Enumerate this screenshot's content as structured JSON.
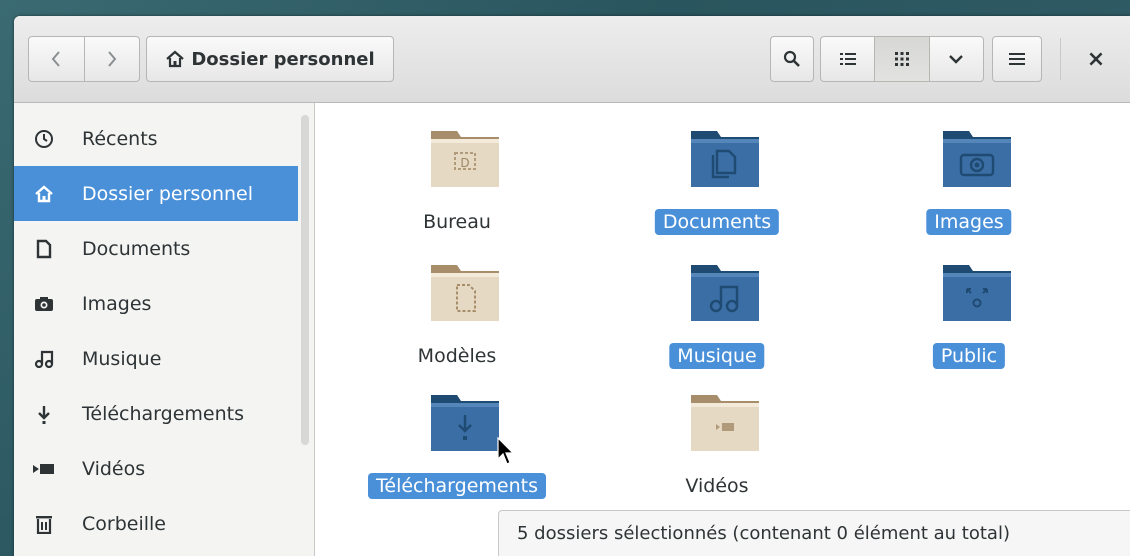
{
  "header": {
    "back_label": "<",
    "forward_label": ">",
    "path_label": "Dossier personnel",
    "close_label": "×"
  },
  "colors": {
    "accent": "#4a90d9",
    "folder_blue": "#3a6ea5",
    "folder_beige": "#e0d4bf"
  },
  "sidebar": {
    "items": [
      {
        "label": "Récents",
        "icon": "clock-icon"
      },
      {
        "label": "Dossier personnel",
        "icon": "home-icon",
        "active": true
      },
      {
        "label": "Documents",
        "icon": "document-icon"
      },
      {
        "label": "Images",
        "icon": "camera-icon"
      },
      {
        "label": "Musique",
        "icon": "music-icon"
      },
      {
        "label": "Téléchargements",
        "icon": "download-icon"
      },
      {
        "label": "Vidéos",
        "icon": "video-icon"
      },
      {
        "label": "Corbeille",
        "icon": "trash-icon"
      }
    ]
  },
  "content": {
    "items": [
      {
        "label": "Bureau",
        "icon": "desktop-folder-icon",
        "selected": false
      },
      {
        "label": "Documents",
        "icon": "documents-folder-icon",
        "selected": true
      },
      {
        "label": "Images",
        "icon": "pictures-folder-icon",
        "selected": true
      },
      {
        "label": "Modèles",
        "icon": "templates-folder-icon",
        "selected": false
      },
      {
        "label": "Musique",
        "icon": "music-folder-icon",
        "selected": true
      },
      {
        "label": "Public",
        "icon": "public-folder-icon",
        "selected": true
      },
      {
        "label": "Téléchargements",
        "icon": "downloads-folder-icon",
        "selected": true
      },
      {
        "label": "Vidéos",
        "icon": "videos-folder-icon",
        "selected": false
      }
    ]
  },
  "status": {
    "text": "5 dossiers sélectionnés  (contenant 0 élément au total)"
  }
}
